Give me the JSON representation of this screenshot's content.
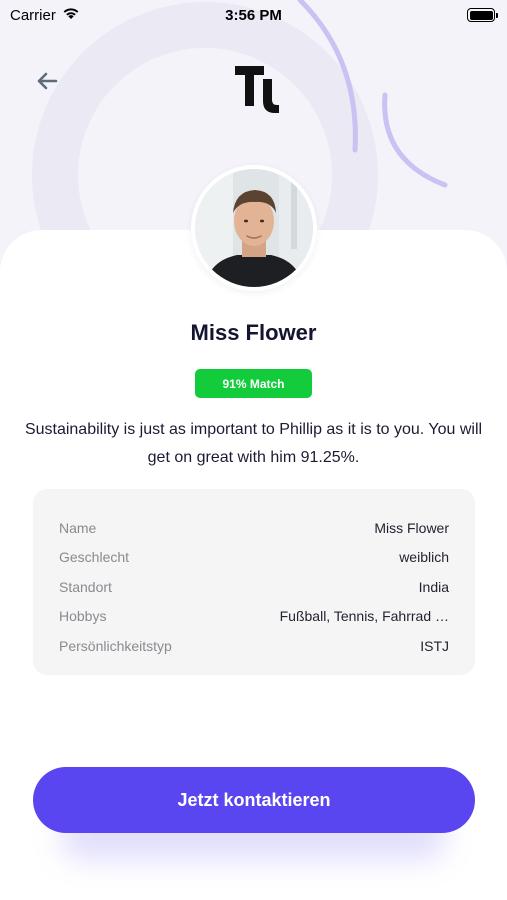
{
  "status_bar": {
    "carrier": "Carrier",
    "time": "3:56 PM"
  },
  "header": {
    "back_icon": "arrow-left-icon",
    "logo_icon": "tl-logo"
  },
  "profile": {
    "name": "Miss Flower",
    "match_label": "91% Match",
    "description": "Sustainability is just as important to Phillip as it is to you. You will get on great with him 91.25%."
  },
  "info": {
    "rows": [
      {
        "label": "Name",
        "value": "Miss Flower"
      },
      {
        "label": "Geschlecht",
        "value": "weiblich"
      },
      {
        "label": "Standort",
        "value": "India"
      },
      {
        "label": "Hobbys",
        "value": "Fußball, Tennis, Fahrrad …"
      },
      {
        "label": "Persönlichkeitstyp",
        "value": "ISTJ"
      }
    ]
  },
  "cta": {
    "label": "Jetzt kontaktieren"
  },
  "colors": {
    "accent": "#5a46f0",
    "match_badge": "#12cc3c",
    "background": "#f4f3fa"
  }
}
